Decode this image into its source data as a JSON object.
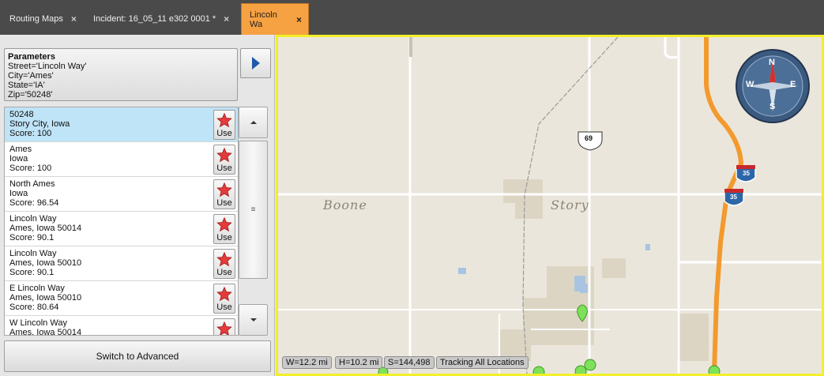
{
  "tabs": [
    {
      "label": "Routing Maps",
      "close": "×"
    },
    {
      "label": "Incident: 16_05_11 e302 0001 *",
      "close": "×"
    },
    {
      "label": "Lincoln Wa",
      "close": "×"
    }
  ],
  "parameters": {
    "title": "Parameters",
    "street": "Street='Lincoln Way'",
    "city": "City='Ames'",
    "state": "State='IA'",
    "zip": "Zip='50248'"
  },
  "results": [
    {
      "line1": "50248",
      "line2": "Story City, Iowa",
      "line3": "Score:  100",
      "use": "Use"
    },
    {
      "line1": "Ames",
      "line2": "Iowa",
      "line3": "Score:  100",
      "use": "Use"
    },
    {
      "line1": "North Ames",
      "line2": "Iowa",
      "line3": "Score:  96.54",
      "use": "Use"
    },
    {
      "line1": "Lincoln Way",
      "line2": "Ames, Iowa  50014",
      "line3": "Score:  90.1",
      "use": "Use"
    },
    {
      "line1": "Lincoln Way",
      "line2": "Ames, Iowa  50010",
      "line3": "Score:  90.1",
      "use": "Use"
    },
    {
      "line1": "E Lincoln Way",
      "line2": "Ames, Iowa  50010",
      "line3": "Score:  80.64",
      "use": "Use"
    },
    {
      "line1": "W Lincoln Way",
      "line2": "Ames, Iowa  50014",
      "line3": "",
      "use": "Use"
    }
  ],
  "switch_button": "Switch to Advanced",
  "map": {
    "counties": [
      "Boone",
      "Story"
    ],
    "highway_69": "69",
    "interstate_35": "35",
    "compass": {
      "n": "N",
      "e": "E",
      "s": "S",
      "w": "W"
    },
    "status": {
      "width": "W=12.2 mi",
      "height": "H=10.2 mi",
      "scale": "S=144,498",
      "tracking": "Tracking All Locations"
    }
  },
  "colors": {
    "active_tab": "#f6a142",
    "selected_row": "#bfe3f7",
    "map_border": "#f2ef2a",
    "interstate": "#f39a2e",
    "marker": "#7fe05a"
  }
}
